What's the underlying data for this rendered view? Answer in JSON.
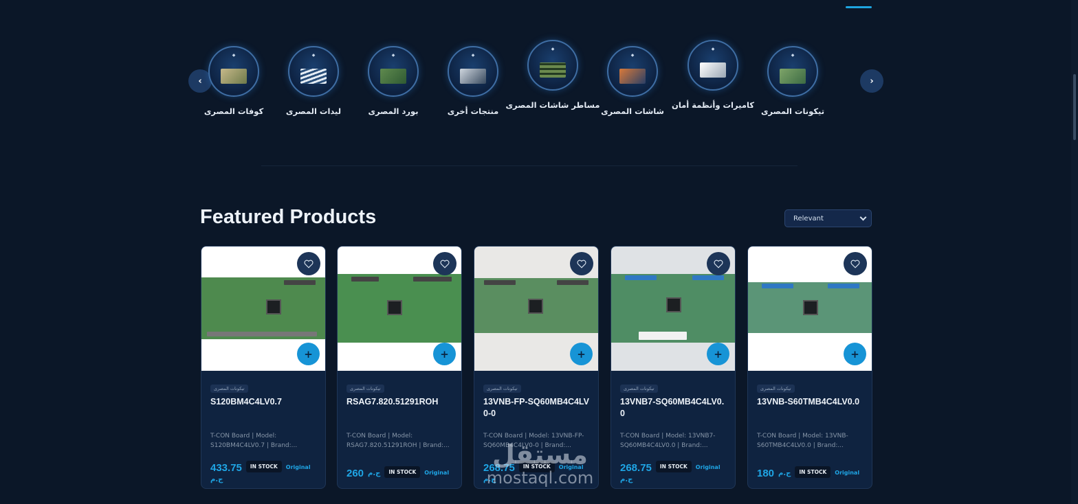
{
  "slider": {
    "prev_icon": "chevron-left-icon",
    "next_icon": "chevron-right-icon",
    "prev_glyph": "‹",
    "next_glyph": "›"
  },
  "categories": [
    {
      "label": "كوفات المصرى"
    },
    {
      "label": "ليدات المصرى"
    },
    {
      "label": "بورد المصرى"
    },
    {
      "label": "منتجات أخرى"
    },
    {
      "label": "مساطر شاشات المصرى"
    },
    {
      "label": "شاشات المصرى"
    },
    {
      "label": "كاميرات وأنظمة أمان"
    },
    {
      "label": "تيكونات المصرى"
    }
  ],
  "featured": {
    "title": "Featured Products",
    "sort_selected": "Relevant"
  },
  "products": [
    {
      "badge": "تيكونات المصرى",
      "title": "S120BM4C4LV0.7",
      "desc": "T-CON Board | Model: S120BM4C4LV0.7 | Brand:...",
      "price": "433.75",
      "currency": "ج.م",
      "stock": "IN STOCK",
      "condition": "Original"
    },
    {
      "badge": "تيكونات المصرى",
      "title": "RSAG7.820.51291ROH",
      "desc": "T-CON Board | Model: RSAG7.820.51291ROH | Brand:...",
      "price": "260",
      "currency": "ج.م",
      "stock": "IN STOCK",
      "condition": "Original"
    },
    {
      "badge": "تيكونات المصرى",
      "title": "13VNB-FP-SQ60MB4C4LV0-0",
      "desc": "T-CON Board | Model: 13VNB-FP-SQ60MB4C4LV0-0 | Brand:...",
      "price": "268.75",
      "currency": "ج.م",
      "stock": "IN STOCK",
      "condition": "Original"
    },
    {
      "badge": "تيكونات المصرى",
      "title": "13VNB7-SQ60MB4C4LV0.0",
      "desc": "T-CON Board | Model: 13VNB7-SQ60MB4C4LV0.0 | Brand:...",
      "price": "268.75",
      "currency": "ج.م",
      "stock": "IN STOCK",
      "condition": "Original"
    },
    {
      "badge": "تيكونات المصرى",
      "title": "13VNB-S60TMB4C4LV0.0",
      "desc": "T-CON Board | Model: 13VNB-S60TMB4C4LV0.0 | Brand:...",
      "price": "180",
      "currency": "ج.م",
      "stock": "IN STOCK",
      "condition": "Original"
    }
  ],
  "watermark": {
    "arabic": "مستقل",
    "latin": "mostaql.com"
  },
  "colors": {
    "background": "#0b1728",
    "accent": "#1fa6e6",
    "card": "#0f2340"
  }
}
